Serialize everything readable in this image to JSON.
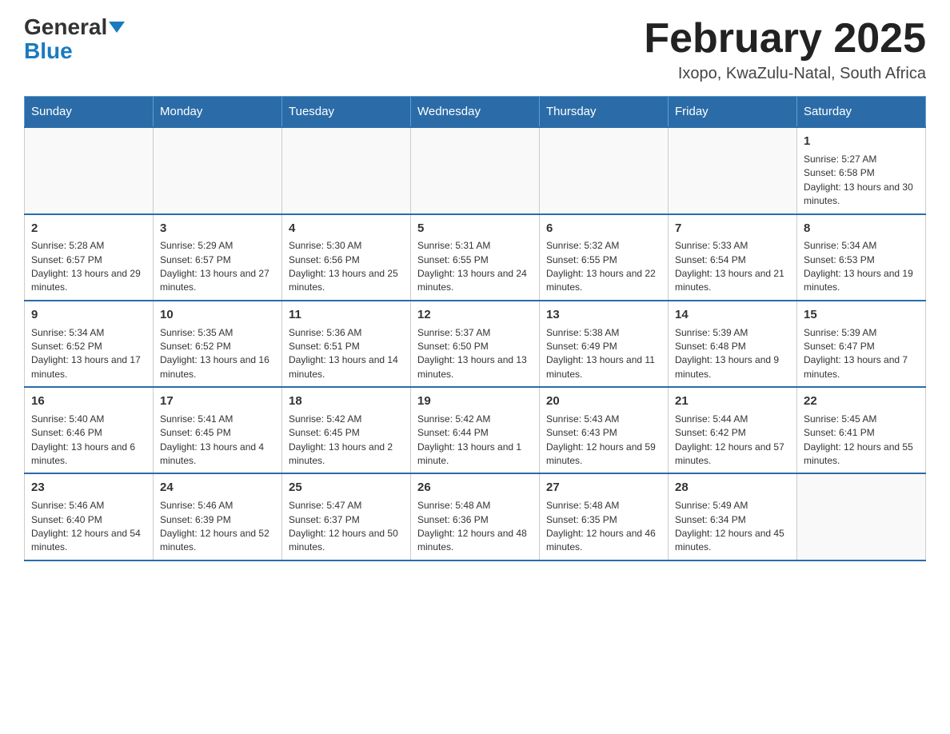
{
  "header": {
    "logo_general": "General",
    "logo_blue": "Blue",
    "main_title": "February 2025",
    "subtitle": "Ixopo, KwaZulu-Natal, South Africa"
  },
  "days_of_week": [
    "Sunday",
    "Monday",
    "Tuesday",
    "Wednesday",
    "Thursday",
    "Friday",
    "Saturday"
  ],
  "weeks": [
    {
      "days": [
        {
          "number": "",
          "info": ""
        },
        {
          "number": "",
          "info": ""
        },
        {
          "number": "",
          "info": ""
        },
        {
          "number": "",
          "info": ""
        },
        {
          "number": "",
          "info": ""
        },
        {
          "number": "",
          "info": ""
        },
        {
          "number": "1",
          "info": "Sunrise: 5:27 AM\nSunset: 6:58 PM\nDaylight: 13 hours and 30 minutes."
        }
      ]
    },
    {
      "days": [
        {
          "number": "2",
          "info": "Sunrise: 5:28 AM\nSunset: 6:57 PM\nDaylight: 13 hours and 29 minutes."
        },
        {
          "number": "3",
          "info": "Sunrise: 5:29 AM\nSunset: 6:57 PM\nDaylight: 13 hours and 27 minutes."
        },
        {
          "number": "4",
          "info": "Sunrise: 5:30 AM\nSunset: 6:56 PM\nDaylight: 13 hours and 25 minutes."
        },
        {
          "number": "5",
          "info": "Sunrise: 5:31 AM\nSunset: 6:55 PM\nDaylight: 13 hours and 24 minutes."
        },
        {
          "number": "6",
          "info": "Sunrise: 5:32 AM\nSunset: 6:55 PM\nDaylight: 13 hours and 22 minutes."
        },
        {
          "number": "7",
          "info": "Sunrise: 5:33 AM\nSunset: 6:54 PM\nDaylight: 13 hours and 21 minutes."
        },
        {
          "number": "8",
          "info": "Sunrise: 5:34 AM\nSunset: 6:53 PM\nDaylight: 13 hours and 19 minutes."
        }
      ]
    },
    {
      "days": [
        {
          "number": "9",
          "info": "Sunrise: 5:34 AM\nSunset: 6:52 PM\nDaylight: 13 hours and 17 minutes."
        },
        {
          "number": "10",
          "info": "Sunrise: 5:35 AM\nSunset: 6:52 PM\nDaylight: 13 hours and 16 minutes."
        },
        {
          "number": "11",
          "info": "Sunrise: 5:36 AM\nSunset: 6:51 PM\nDaylight: 13 hours and 14 minutes."
        },
        {
          "number": "12",
          "info": "Sunrise: 5:37 AM\nSunset: 6:50 PM\nDaylight: 13 hours and 13 minutes."
        },
        {
          "number": "13",
          "info": "Sunrise: 5:38 AM\nSunset: 6:49 PM\nDaylight: 13 hours and 11 minutes."
        },
        {
          "number": "14",
          "info": "Sunrise: 5:39 AM\nSunset: 6:48 PM\nDaylight: 13 hours and 9 minutes."
        },
        {
          "number": "15",
          "info": "Sunrise: 5:39 AM\nSunset: 6:47 PM\nDaylight: 13 hours and 7 minutes."
        }
      ]
    },
    {
      "days": [
        {
          "number": "16",
          "info": "Sunrise: 5:40 AM\nSunset: 6:46 PM\nDaylight: 13 hours and 6 minutes."
        },
        {
          "number": "17",
          "info": "Sunrise: 5:41 AM\nSunset: 6:45 PM\nDaylight: 13 hours and 4 minutes."
        },
        {
          "number": "18",
          "info": "Sunrise: 5:42 AM\nSunset: 6:45 PM\nDaylight: 13 hours and 2 minutes."
        },
        {
          "number": "19",
          "info": "Sunrise: 5:42 AM\nSunset: 6:44 PM\nDaylight: 13 hours and 1 minute."
        },
        {
          "number": "20",
          "info": "Sunrise: 5:43 AM\nSunset: 6:43 PM\nDaylight: 12 hours and 59 minutes."
        },
        {
          "number": "21",
          "info": "Sunrise: 5:44 AM\nSunset: 6:42 PM\nDaylight: 12 hours and 57 minutes."
        },
        {
          "number": "22",
          "info": "Sunrise: 5:45 AM\nSunset: 6:41 PM\nDaylight: 12 hours and 55 minutes."
        }
      ]
    },
    {
      "days": [
        {
          "number": "23",
          "info": "Sunrise: 5:46 AM\nSunset: 6:40 PM\nDaylight: 12 hours and 54 minutes."
        },
        {
          "number": "24",
          "info": "Sunrise: 5:46 AM\nSunset: 6:39 PM\nDaylight: 12 hours and 52 minutes."
        },
        {
          "number": "25",
          "info": "Sunrise: 5:47 AM\nSunset: 6:37 PM\nDaylight: 12 hours and 50 minutes."
        },
        {
          "number": "26",
          "info": "Sunrise: 5:48 AM\nSunset: 6:36 PM\nDaylight: 12 hours and 48 minutes."
        },
        {
          "number": "27",
          "info": "Sunrise: 5:48 AM\nSunset: 6:35 PM\nDaylight: 12 hours and 46 minutes."
        },
        {
          "number": "28",
          "info": "Sunrise: 5:49 AM\nSunset: 6:34 PM\nDaylight: 12 hours and 45 minutes."
        },
        {
          "number": "",
          "info": ""
        }
      ]
    }
  ]
}
